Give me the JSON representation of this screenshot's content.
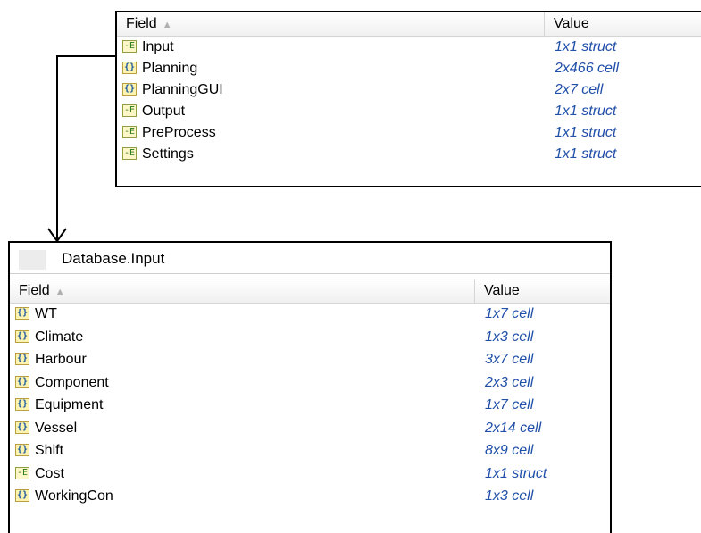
{
  "top_table": {
    "header": {
      "field": "Field",
      "value": "Value"
    },
    "rows": [
      {
        "name": "Input",
        "value": "1x1 struct",
        "icon": "struct-icon"
      },
      {
        "name": "Planning",
        "value": "2x466 cell",
        "icon": "cell-icon"
      },
      {
        "name": "PlanningGUI",
        "value": "2x7 cell",
        "icon": "cell-icon"
      },
      {
        "name": "Output",
        "value": "1x1 struct",
        "icon": "struct-icon"
      },
      {
        "name": "PreProcess",
        "value": "1x1 struct",
        "icon": "struct-icon"
      },
      {
        "name": "Settings",
        "value": "1x1 struct",
        "icon": "struct-icon"
      }
    ]
  },
  "bottom_table": {
    "title": "Database.Input",
    "header": {
      "field": "Field",
      "value": "Value"
    },
    "rows": [
      {
        "name": "WT",
        "value": "1x7 cell",
        "icon": "cell-icon"
      },
      {
        "name": "Climate",
        "value": "1x3 cell",
        "icon": "cell-icon"
      },
      {
        "name": "Harbour",
        "value": "3x7 cell",
        "icon": "cell-icon"
      },
      {
        "name": "Component",
        "value": "2x3 cell",
        "icon": "cell-icon"
      },
      {
        "name": "Equipment",
        "value": "1x7 cell",
        "icon": "cell-icon"
      },
      {
        "name": "Vessel",
        "value": "2x14 cell",
        "icon": "cell-icon"
      },
      {
        "name": "Shift",
        "value": "8x9 cell",
        "icon": "cell-icon"
      },
      {
        "name": "Cost",
        "value": "1x1 struct",
        "icon": "struct-icon"
      },
      {
        "name": "WorkingCon",
        "value": "1x3 cell",
        "icon": "cell-icon"
      }
    ]
  },
  "icons": {
    "cell_glyph": "{}",
    "struct_glyph": "-E"
  },
  "colors": {
    "value_text": "#1f4fa8",
    "border": "#000000",
    "header_divider": "#d5d5d5"
  }
}
